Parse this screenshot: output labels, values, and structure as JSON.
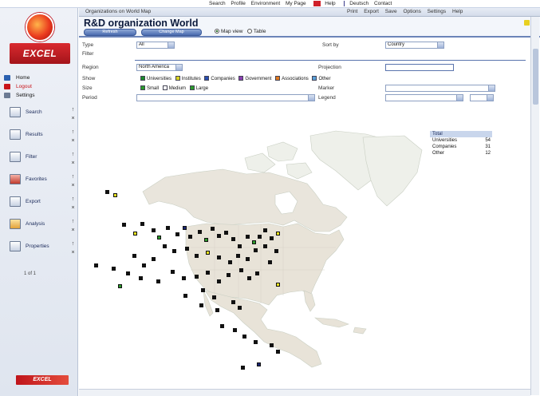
{
  "topbar": {
    "links": [
      "Search",
      "Profile",
      "Environment",
      "My Page",
      "Help",
      "Deutsch",
      "Contact"
    ],
    "flag_color": "#d0202a"
  },
  "logo": {
    "text": "EXCEL"
  },
  "sidebar": {
    "nav": [
      {
        "label": "Home",
        "icon": "house-icon",
        "color": "#2a60b0",
        "red": false
      },
      {
        "label": "Logout",
        "icon": "exit-icon",
        "color": "#c8141a",
        "red": true
      },
      {
        "label": "Settings",
        "icon": "wrench-icon",
        "color": "#6b7a93",
        "red": false
      }
    ],
    "tools": [
      {
        "label": "Search",
        "icon": "search-tool-icon"
      },
      {
        "label": "Results",
        "icon": "results-icon"
      },
      {
        "label": "Filter",
        "icon": "filter-icon"
      },
      {
        "label": "Favorites",
        "icon": "favorites-icon"
      },
      {
        "label": "Export",
        "icon": "export-icon"
      },
      {
        "label": "Analysis",
        "icon": "analysis-icon"
      },
      {
        "label": "Properties",
        "icon": "properties-icon"
      }
    ],
    "counter": "1 of 1",
    "footer_logo": "EXCEL"
  },
  "main": {
    "tabbar_left": "Organizations on World Map",
    "tabbar_right": [
      "Print",
      "Export",
      "Save",
      "Options",
      "Settings",
      "Help"
    ],
    "title": "R&D organization World",
    "buttons": [
      "Refresh",
      "Change Map"
    ],
    "radios": [
      {
        "label": "Map view",
        "on": true
      },
      {
        "label": "Table",
        "on": false
      }
    ],
    "form": {
      "row1_label": "Type",
      "row1_value": "All",
      "row1_label2": "Sort by",
      "row1_value2": "Country",
      "row2_label": "Filter",
      "region_label": "Region",
      "region_value": "North America",
      "region_right_label": "Projection",
      "series_label": "Show",
      "series": [
        {
          "name": "Universities",
          "color": "#1b8a2c"
        },
        {
          "name": "Institutes",
          "color": "#d9d420"
        },
        {
          "name": "Companies",
          "color": "#2a4fb0"
        },
        {
          "name": "Government",
          "color": "#8a3fb0"
        },
        {
          "name": "Associations",
          "color": "#e07a1f"
        },
        {
          "name": "Other",
          "color": "#5aa0d8"
        }
      ],
      "size_label": "Size",
      "size_options": [
        "Small",
        "Medium",
        "Large"
      ],
      "size_right_label": "Marker",
      "period_label": "Period",
      "period_right_label": "Legend"
    },
    "legend": {
      "title": "Total",
      "rows": [
        {
          "label": "Universities",
          "value": "54"
        },
        {
          "label": "Companies",
          "value": "31"
        },
        {
          "label": "Other",
          "value": "12"
        }
      ]
    },
    "marker_colors": {
      "black": "#111111",
      "yellow": "#e8e21e",
      "green": "#2b9a2b",
      "navy": "#1a2670"
    }
  }
}
